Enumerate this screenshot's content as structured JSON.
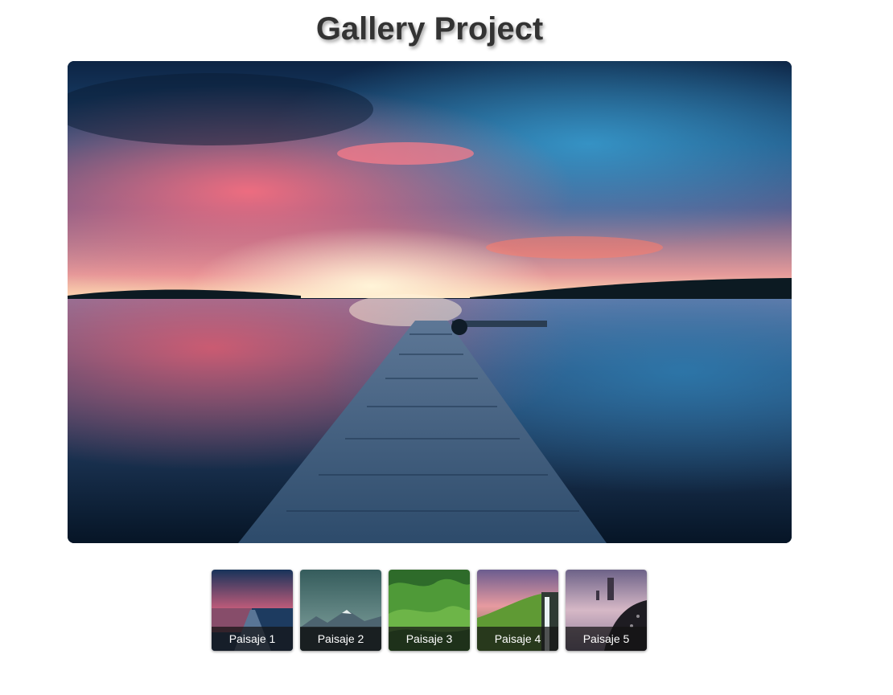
{
  "page": {
    "title": "Gallery Project"
  },
  "gallery": {
    "active_index": 0,
    "thumbnails": [
      {
        "label": "Paisaje 1",
        "icon": "sunset-pier-image"
      },
      {
        "label": "Paisaje 2",
        "icon": "mountain-image"
      },
      {
        "label": "Paisaje 3",
        "icon": "green-hills-image"
      },
      {
        "label": "Paisaje 4",
        "icon": "waterfall-image"
      },
      {
        "label": "Paisaje 5",
        "icon": "coast-rocks-image"
      }
    ]
  }
}
